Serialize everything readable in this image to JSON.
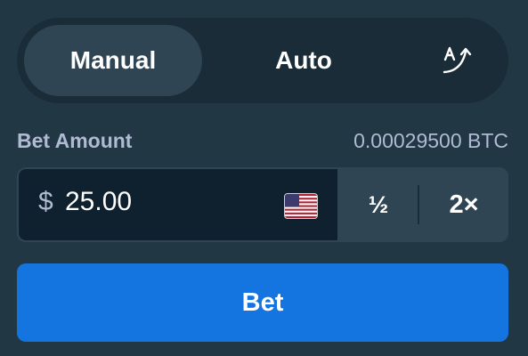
{
  "mode_tabs": {
    "manual_label": "Manual",
    "auto_label": "Auto",
    "extra_icon": "auto-betting-arrow-icon"
  },
  "bet_amount": {
    "label": "Bet Amount",
    "crypto_equivalent": "0.00029500 BTC",
    "currency_symbol": "$",
    "value": "25.00",
    "currency_flag_icon": "us-flag-icon",
    "half_label": "½",
    "double_label": "2×"
  },
  "bet_button": {
    "label": "Bet"
  },
  "colors": {
    "background": "#213743",
    "panel": "#1a2c38",
    "active_tab": "#2f4553",
    "input_bg": "#0f212e",
    "primary": "#1475e1",
    "muted_text": "#b1bad3"
  }
}
